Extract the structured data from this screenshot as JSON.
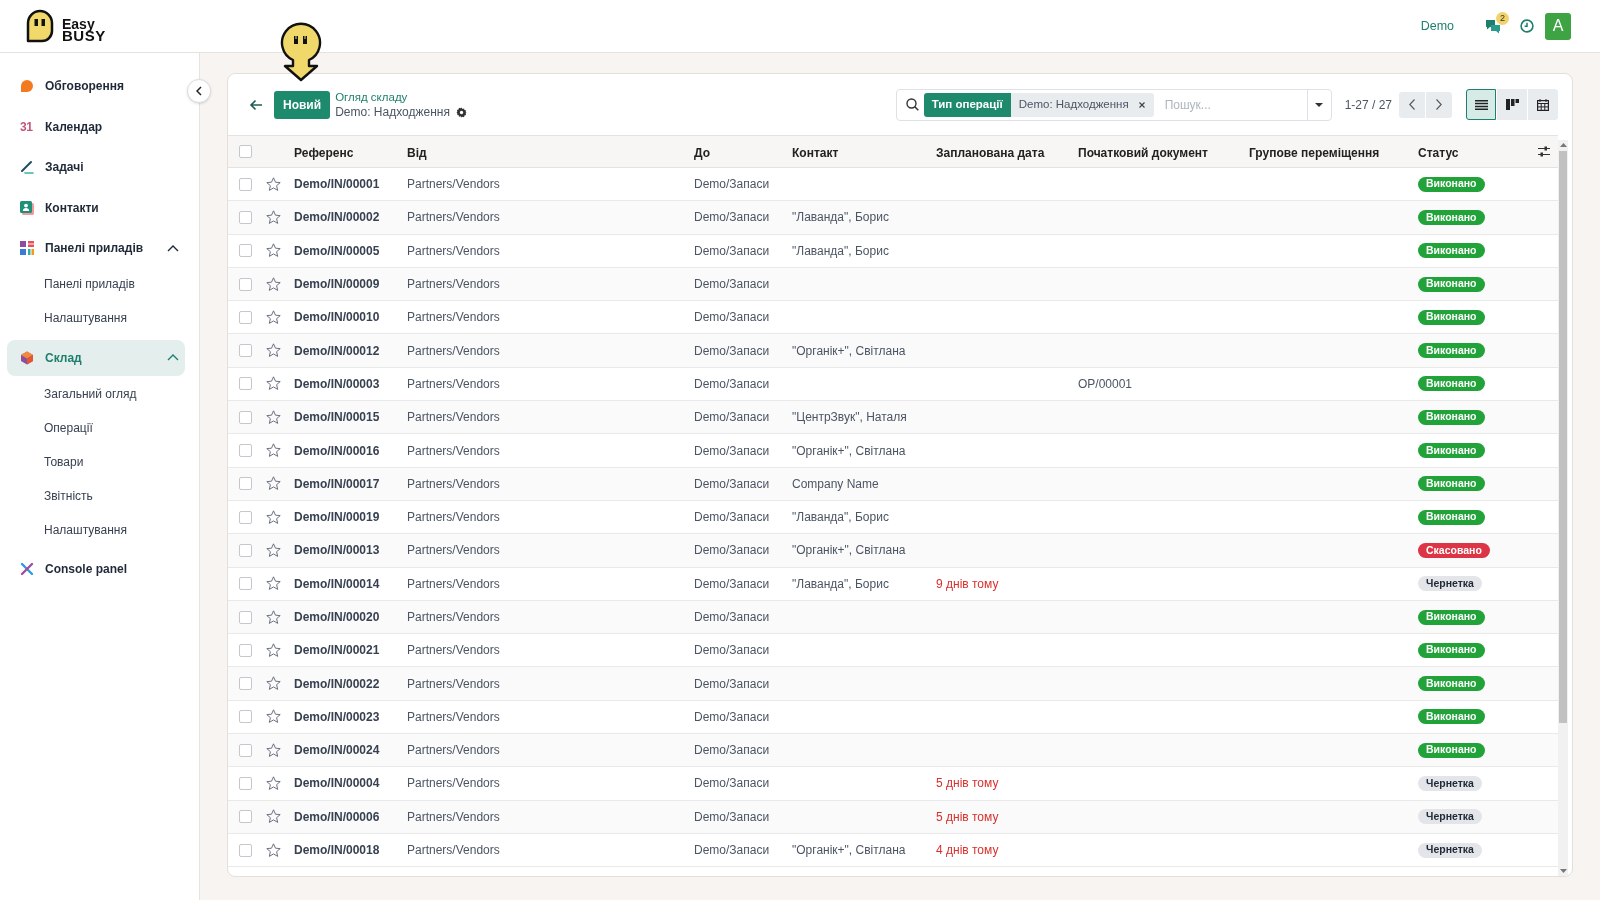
{
  "logo": {
    "line_1": "Easy",
    "line_2": "BUSY"
  },
  "top_bar": {
    "company": "Demo",
    "message_count": "2",
    "avatar_letter": "A"
  },
  "sidebar": {
    "items": [
      {
        "label": "Обговорення",
        "selected": false
      },
      {
        "label": "Календар",
        "glyph": "31",
        "selected": false
      },
      {
        "label": "Задачі",
        "selected": false
      },
      {
        "label": "Контакти",
        "selected": false
      },
      {
        "label": "Панелі приладів",
        "selected": false,
        "expanded": true,
        "children": [
          {
            "label": "Панелі приладів",
            "selected": false
          },
          {
            "label": "Налаштування",
            "selected": false
          }
        ]
      },
      {
        "label": "Склад",
        "selected": true,
        "expanded": true,
        "children": [
          {
            "label": "Загальний огляд",
            "selected": false
          },
          {
            "label": "Операції",
            "selected": false
          },
          {
            "label": "Товари",
            "selected": false
          },
          {
            "label": "Звітність",
            "selected": false
          },
          {
            "label": "Налаштування",
            "selected": false
          }
        ]
      },
      {
        "label": "Console panel",
        "selected": false
      }
    ]
  },
  "control_panel": {
    "new_button": "Новий",
    "breadcrumb": "Огляд складу",
    "title": "Demo: Надходження",
    "search": {
      "facets": [
        {
          "label": "Тип операції",
          "value": "Demo: Надходження"
        }
      ],
      "placeholder": "Пошук..."
    },
    "pager": "1-27 / 27",
    "views": [
      {
        "kind": "list",
        "selected": true
      },
      {
        "kind": "kanban",
        "selected": false
      },
      {
        "kind": "calendar",
        "selected": false
      }
    ]
  },
  "table": {
    "all_selected": false,
    "columns": [
      "Референс",
      "Від",
      "До",
      "Контакт",
      "Запланована дата",
      "Початковий документ",
      "Групове переміщення",
      "Статус"
    ],
    "rows": [
      {
        "selected": false,
        "starred": false,
        "reference": "Demo/IN/00001",
        "from": "Partners/Vendors",
        "to": "Demo/Запаси",
        "status": {
          "label": "Виконано",
          "kind": "done"
        }
      },
      {
        "selected": false,
        "starred": false,
        "reference": "Demo/IN/00002",
        "from": "Partners/Vendors",
        "to": "Demo/Запаси",
        "contact": "\"Лаванда\", Борис",
        "status": {
          "label": "Виконано",
          "kind": "done"
        }
      },
      {
        "selected": false,
        "starred": false,
        "reference": "Demo/IN/00005",
        "from": "Partners/Vendors",
        "to": "Demo/Запаси",
        "contact": "\"Лаванда\", Борис",
        "status": {
          "label": "Виконано",
          "kind": "done"
        }
      },
      {
        "selected": false,
        "starred": false,
        "reference": "Demo/IN/00009",
        "from": "Partners/Vendors",
        "to": "Demo/Запаси",
        "status": {
          "label": "Виконано",
          "kind": "done"
        }
      },
      {
        "selected": false,
        "starred": false,
        "reference": "Demo/IN/00010",
        "from": "Partners/Vendors",
        "to": "Demo/Запаси",
        "status": {
          "label": "Виконано",
          "kind": "done"
        }
      },
      {
        "selected": false,
        "starred": false,
        "reference": "Demo/IN/00012",
        "from": "Partners/Vendors",
        "to": "Demo/Запаси",
        "contact": "\"Органік+\", Світлана",
        "status": {
          "label": "Виконано",
          "kind": "done"
        }
      },
      {
        "selected": false,
        "starred": false,
        "reference": "Demo/IN/00003",
        "from": "Partners/Vendors",
        "to": "Demo/Запаси",
        "source_document": "OP/00001",
        "status": {
          "label": "Виконано",
          "kind": "done"
        }
      },
      {
        "selected": false,
        "starred": false,
        "reference": "Demo/IN/00015",
        "from": "Partners/Vendors",
        "to": "Demo/Запаси",
        "contact": "\"ЦентрЗвук\", Наталя",
        "status": {
          "label": "Виконано",
          "kind": "done"
        }
      },
      {
        "selected": false,
        "starred": false,
        "reference": "Demo/IN/00016",
        "from": "Partners/Vendors",
        "to": "Demo/Запаси",
        "contact": "\"Органік+\", Світлана",
        "status": {
          "label": "Виконано",
          "kind": "done"
        }
      },
      {
        "selected": false,
        "starred": false,
        "reference": "Demo/IN/00017",
        "from": "Partners/Vendors",
        "to": "Demo/Запаси",
        "contact": "Company Name",
        "status": {
          "label": "Виконано",
          "kind": "done"
        }
      },
      {
        "selected": false,
        "starred": false,
        "reference": "Demo/IN/00019",
        "from": "Partners/Vendors",
        "to": "Demo/Запаси",
        "contact": "\"Лаванда\", Борис",
        "status": {
          "label": "Виконано",
          "kind": "done"
        }
      },
      {
        "selected": false,
        "starred": false,
        "reference": "Demo/IN/00013",
        "from": "Partners/Vendors",
        "to": "Demo/Запаси",
        "contact": "\"Органік+\", Світлана",
        "status": {
          "label": "Скасовано",
          "kind": "cancelled"
        }
      },
      {
        "selected": false,
        "starred": false,
        "reference": "Demo/IN/00014",
        "from": "Partners/Vendors",
        "to": "Demo/Запаси",
        "contact": "\"Лаванда\", Борис",
        "scheduled_date": "9 днів тому",
        "status": {
          "label": "Чернетка",
          "kind": "draft"
        }
      },
      {
        "selected": false,
        "starred": false,
        "reference": "Demo/IN/00020",
        "from": "Partners/Vendors",
        "to": "Demo/Запаси",
        "status": {
          "label": "Виконано",
          "kind": "done"
        }
      },
      {
        "selected": false,
        "starred": false,
        "reference": "Demo/IN/00021",
        "from": "Partners/Vendors",
        "to": "Demo/Запаси",
        "status": {
          "label": "Виконано",
          "kind": "done"
        }
      },
      {
        "selected": false,
        "starred": false,
        "reference": "Demo/IN/00022",
        "from": "Partners/Vendors",
        "to": "Demo/Запаси",
        "status": {
          "label": "Виконано",
          "kind": "done"
        }
      },
      {
        "selected": false,
        "starred": false,
        "reference": "Demo/IN/00023",
        "from": "Partners/Vendors",
        "to": "Demo/Запаси",
        "status": {
          "label": "Виконано",
          "kind": "done"
        }
      },
      {
        "selected": false,
        "starred": false,
        "reference": "Demo/IN/00024",
        "from": "Partners/Vendors",
        "to": "Demo/Запаси",
        "status": {
          "label": "Виконано",
          "kind": "done"
        }
      },
      {
        "selected": false,
        "starred": false,
        "reference": "Demo/IN/00004",
        "from": "Partners/Vendors",
        "to": "Demo/Запаси",
        "scheduled_date": "5 днів тому",
        "status": {
          "label": "Чернетка",
          "kind": "draft"
        }
      },
      {
        "selected": false,
        "starred": false,
        "reference": "Demo/IN/00006",
        "from": "Partners/Vendors",
        "to": "Demo/Запаси",
        "scheduled_date": "5 днів тому",
        "status": {
          "label": "Чернетка",
          "kind": "draft"
        }
      },
      {
        "selected": false,
        "starred": false,
        "reference": "Demo/IN/00018",
        "from": "Partners/Vendors",
        "to": "Demo/Запаси",
        "contact": "\"Органік+\", Світлана",
        "scheduled_date": "4 днів тому",
        "status": {
          "label": "Чернетка",
          "kind": "draft"
        }
      }
    ]
  }
}
